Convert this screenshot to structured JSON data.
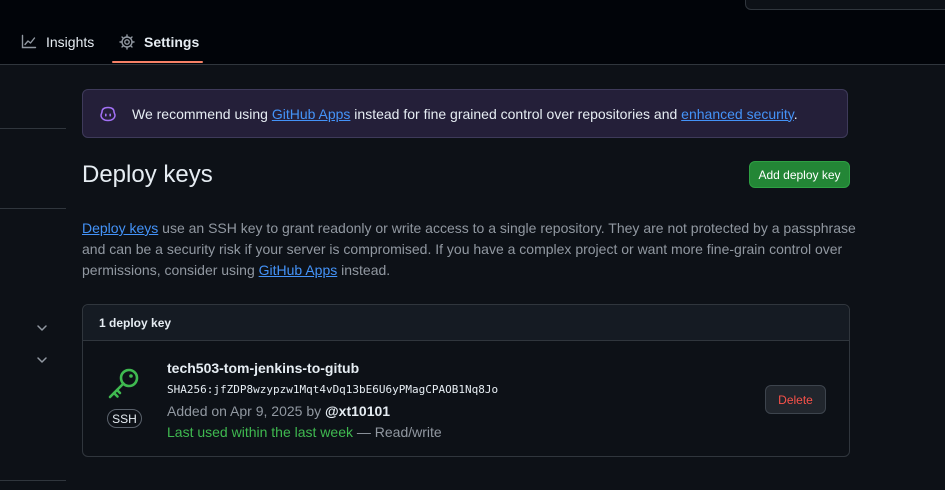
{
  "nav": {
    "insights_label": "Insights",
    "settings_label": "Settings",
    "active_tab_color": "#f78166"
  },
  "banner": {
    "text_before": "We recommend using ",
    "link1": "GitHub Apps",
    "text_middle": " instead for fine grained control over repositories and ",
    "link2": "enhanced security",
    "text_after": ".",
    "icon": "copilot-icon"
  },
  "page": {
    "title": "Deploy keys",
    "add_button": "Add deploy key"
  },
  "description": {
    "link1": "Deploy keys",
    "text1": " use an SSH key to grant readonly or write access to a single repository. They are not protected by a passphrase and can be a security risk if your server is compromised. If you have a complex project or want more fine-grain control over permissions, consider using ",
    "link2": "GitHub Apps",
    "text2": " instead."
  },
  "keys": {
    "count_label": "1 deploy key",
    "items": [
      {
        "title": "tech503-tom-jenkins-to-gitub",
        "fingerprint": "SHA256:jfZDP8wzypzw1Mqt4vDq13bE6U6yPMagCPAOB1Nq8Jo",
        "added_prefix": "Added on Apr 9, 2025 by ",
        "added_by": "@xt10101",
        "last_used": "Last used within the last week",
        "access": " — Read/write",
        "type_badge": "SSH",
        "delete_label": "Delete",
        "icon": "key-icon"
      }
    ]
  },
  "colors": {
    "primary_button": "#238636",
    "danger_text": "#f85149",
    "link": "#4493f8",
    "key_icon": "#3fb950"
  }
}
